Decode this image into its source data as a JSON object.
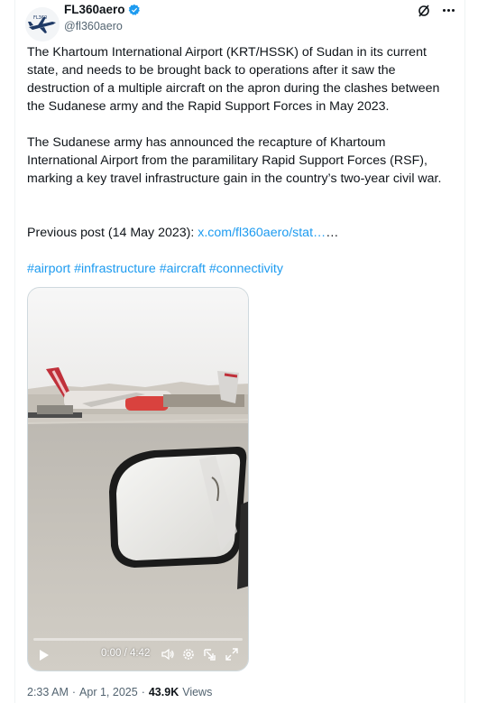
{
  "author": {
    "display_name": "FL360aero",
    "username": "@fl360aero",
    "avatar_icon": "airplane-logo-icon",
    "verified": true
  },
  "post": {
    "paragraph_1": "The Khartoum International Airport (KRT/HSSK) of Sudan in its current state, and needs to be brought back to operations after it saw the destruction of a multiple aircraft on the apron during the clashes between the Sudanese army and the Rapid Support Forces in May 2023.",
    "paragraph_2": "The Sudanese army has announced the recapture of Khartoum International Airport from the paramilitary Rapid Support Forces (RSF), marking a key travel infrastructure gain in the country’s two-year civil war.",
    "previous_label": "Previous post (14 May 2023): ",
    "previous_link": "x.com/fl360aero/stat…",
    "previous_trailer": "…",
    "hashtags": [
      "#airport",
      "#infrastructure",
      "#aircraft",
      "#connectivity"
    ]
  },
  "video": {
    "time": "0:00 / 4:42",
    "progress": 0
  },
  "footer": {
    "time": "2:33 AM",
    "separator": "·",
    "date": "Apr 1, 2025",
    "separator2": "·",
    "views_count": "43.9K",
    "views_label": "Views"
  },
  "colors": {
    "link": "#1d9bf0",
    "verified": "#1d9bf0",
    "secondary_text": "#536471"
  }
}
